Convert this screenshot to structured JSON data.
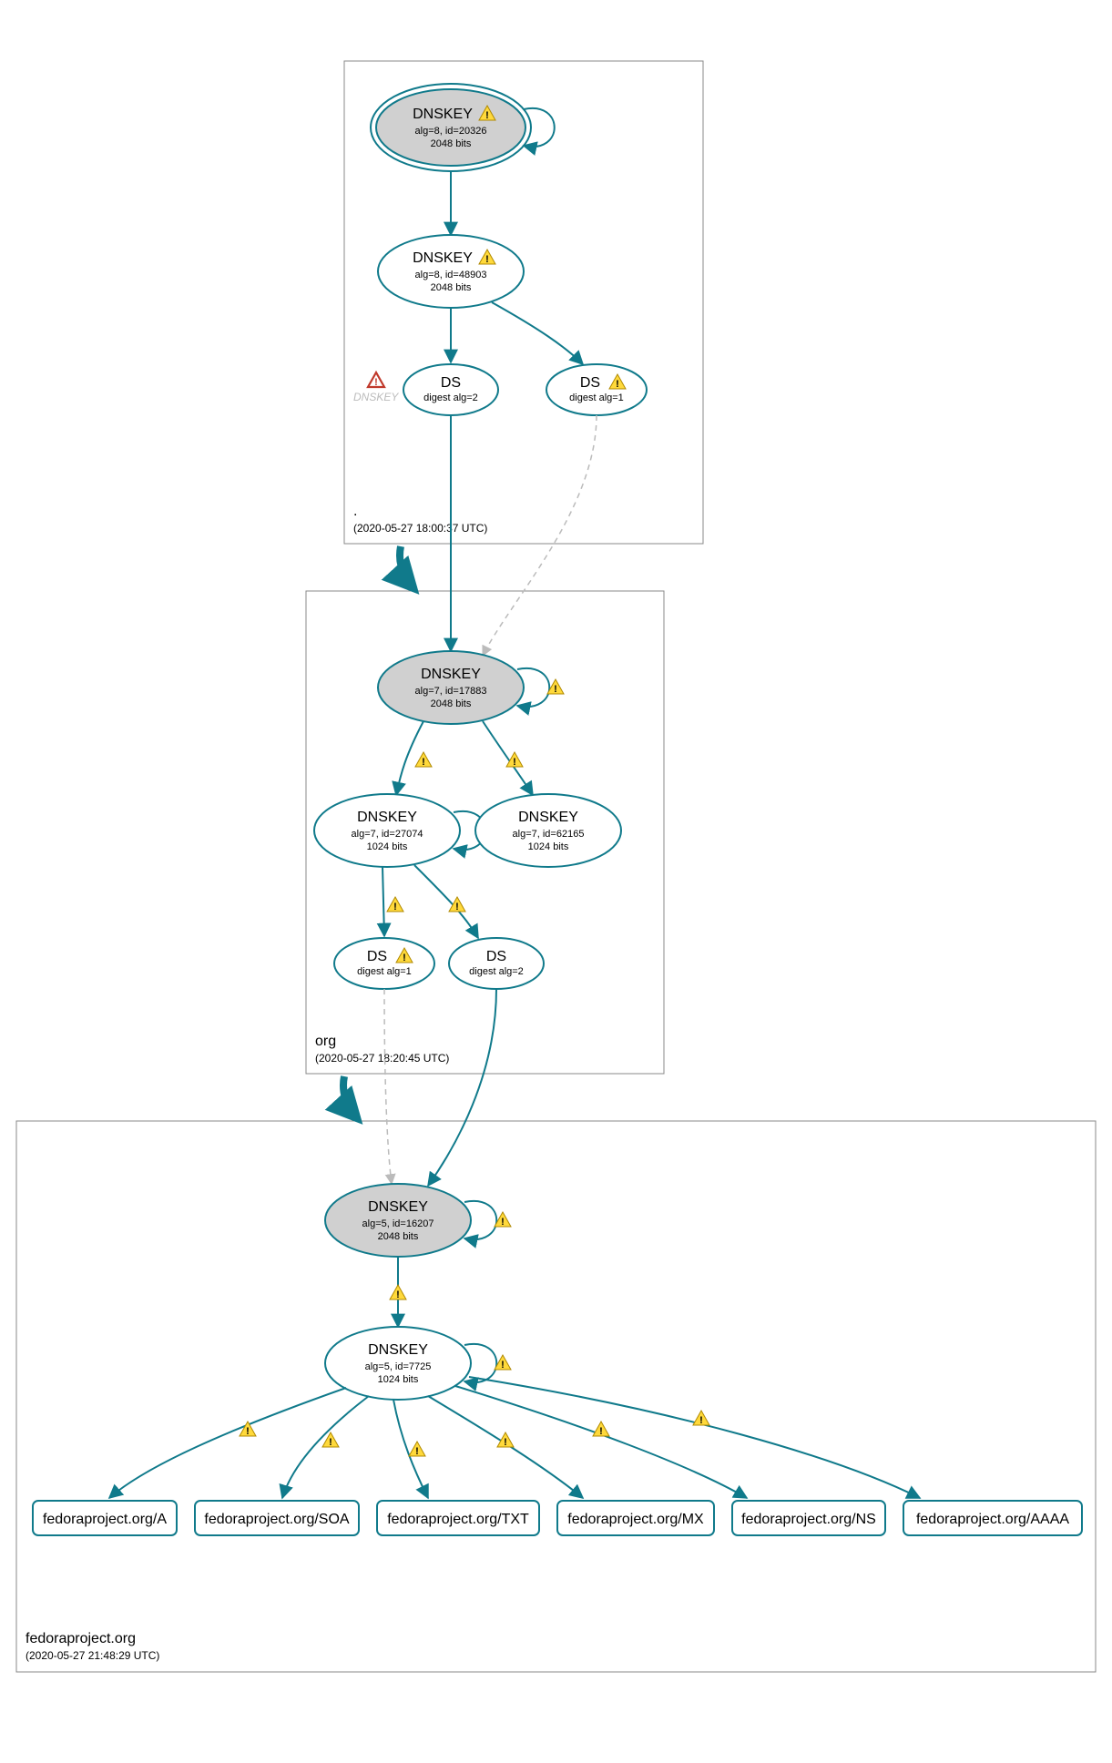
{
  "zones": {
    "root": {
      "label": ".",
      "timestamp": "(2020-05-27 18:00:37 UTC)"
    },
    "org": {
      "label": "org",
      "timestamp": "(2020-05-27 18:20:45 UTC)"
    },
    "fedora": {
      "label": "fedoraproject.org",
      "timestamp": "(2020-05-27 21:48:29 UTC)"
    }
  },
  "nodes": {
    "root_ksk": {
      "title": "DNSKEY",
      "alg": "alg=8, id=20326",
      "bits": "2048 bits"
    },
    "root_zsk": {
      "title": "DNSKEY",
      "alg": "alg=8, id=48903",
      "bits": "2048 bits"
    },
    "root_ds1": {
      "title": "DS",
      "digest": "digest alg=2"
    },
    "root_ds2": {
      "title": "DS",
      "digest": "digest alg=1"
    },
    "ghost_label": "DNSKEY",
    "org_ksk": {
      "title": "DNSKEY",
      "alg": "alg=7, id=17883",
      "bits": "2048 bits"
    },
    "org_zsk1": {
      "title": "DNSKEY",
      "alg": "alg=7, id=27074",
      "bits": "1024 bits"
    },
    "org_zsk2": {
      "title": "DNSKEY",
      "alg": "alg=7, id=62165",
      "bits": "1024 bits"
    },
    "org_ds1": {
      "title": "DS",
      "digest": "digest alg=1"
    },
    "org_ds2": {
      "title": "DS",
      "digest": "digest alg=2"
    },
    "fed_ksk": {
      "title": "DNSKEY",
      "alg": "alg=5, id=16207",
      "bits": "2048 bits"
    },
    "fed_zsk": {
      "title": "DNSKEY",
      "alg": "alg=5, id=7725",
      "bits": "1024 bits"
    }
  },
  "records": {
    "a": "fedoraproject.org/A",
    "soa": "fedoraproject.org/SOA",
    "txt": "fedoraproject.org/TXT",
    "mx": "fedoraproject.org/MX",
    "ns": "fedoraproject.org/NS",
    "aaaa": "fedoraproject.org/AAAA"
  }
}
